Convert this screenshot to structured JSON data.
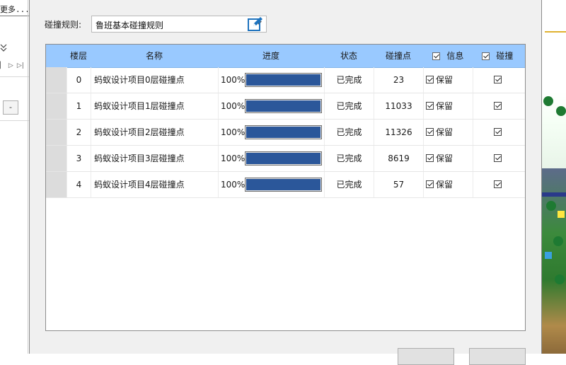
{
  "background_left": {
    "more_text": "更多...",
    "minus_label": "-"
  },
  "dialog": {
    "rule_label": "碰撞规则:",
    "rule_selected": "鲁班基本碰撞规则",
    "columns": {
      "floor": "楼层",
      "name": "名称",
      "progress": "进度",
      "status": "状态",
      "count": "碰撞点",
      "info": "信息",
      "collision": "碰撞"
    },
    "rows": [
      {
        "floor": "0",
        "name": "蚂蚁设计项目0层碰撞点",
        "progress_text": "100%",
        "progress": 100,
        "status": "已完成",
        "count": "23",
        "keep": "保留",
        "keep_checked": true,
        "collide_checked": true
      },
      {
        "floor": "1",
        "name": "蚂蚁设计项目1层碰撞点",
        "progress_text": "100%",
        "progress": 100,
        "status": "已完成",
        "count": "11033",
        "keep": "保留",
        "keep_checked": true,
        "collide_checked": true
      },
      {
        "floor": "2",
        "name": "蚂蚁设计项目2层碰撞点",
        "progress_text": "100%",
        "progress": 100,
        "status": "已完成",
        "count": "11326",
        "keep": "保留",
        "keep_checked": true,
        "collide_checked": true
      },
      {
        "floor": "3",
        "name": "蚂蚁设计项目3层碰撞点",
        "progress_text": "100%",
        "progress": 100,
        "status": "已完成",
        "count": "8619",
        "keep": "保留",
        "keep_checked": true,
        "collide_checked": true
      },
      {
        "floor": "4",
        "name": "蚂蚁设计项目4层碰撞点",
        "progress_text": "100%",
        "progress": 100,
        "status": "已完成",
        "count": "57",
        "keep": "保留",
        "keep_checked": true,
        "collide_checked": true
      }
    ],
    "header_info_checked": true,
    "header_collision_checked": true
  },
  "colors": {
    "header_bg": "#99c9ff",
    "progress_fill": "#2b579a",
    "dialog_bg": "#f0f0f0",
    "edit_icon": "#1e73be"
  },
  "icons": {
    "edit": "edit-icon",
    "dropdown": "chevron-down-icon",
    "checkbox": "checkbox-checked-icon"
  }
}
